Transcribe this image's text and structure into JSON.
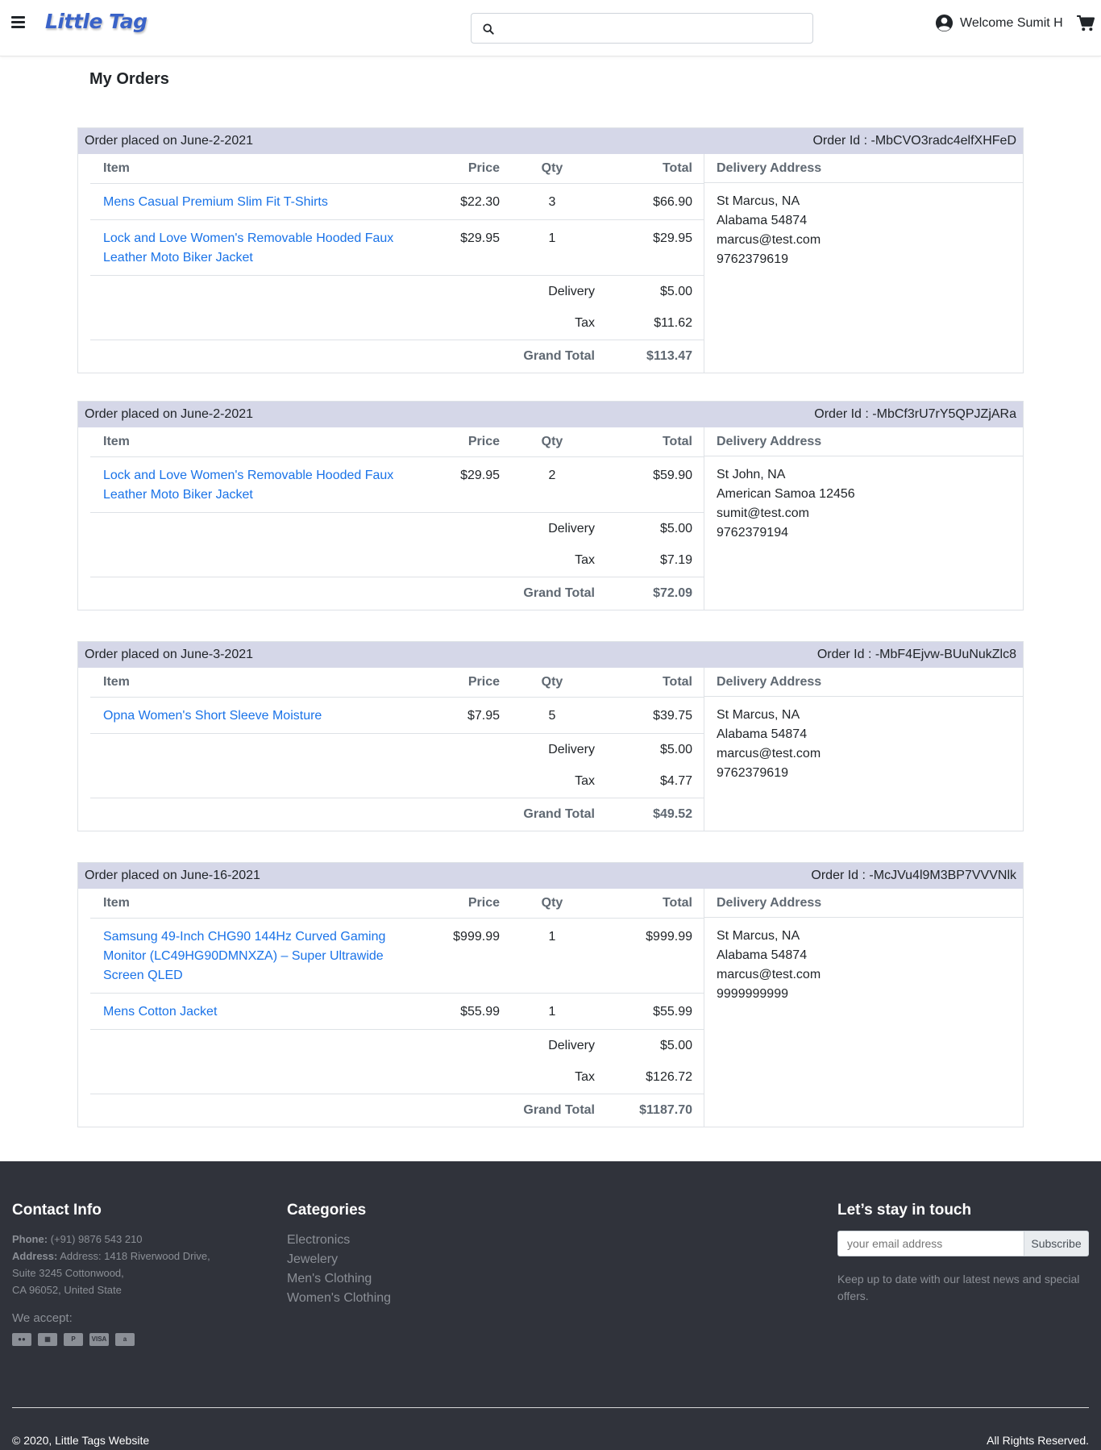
{
  "header": {
    "logo": "Little Tag",
    "search_placeholder": "",
    "welcome": "Welcome Sumit H"
  },
  "page_title": "My Orders",
  "columns": {
    "item": "Item",
    "price": "Price",
    "qty": "Qty",
    "total": "Total",
    "delivery_address": "Delivery Address"
  },
  "summary_labels": {
    "delivery": "Delivery",
    "tax": "Tax",
    "grand_total": "Grand Total"
  },
  "orders": [
    {
      "placed": "Order placed on June-2-2021",
      "order_id": "Order Id : -MbCVO3radc4elfXHFeD",
      "items": [
        {
          "name": "Mens Casual Premium Slim Fit T-Shirts",
          "price": "$22.30",
          "qty": "3",
          "total": "$66.90"
        },
        {
          "name": "Lock and Love Women's Removable Hooded Faux Leather Moto Biker Jacket",
          "price": "$29.95",
          "qty": "1",
          "total": "$29.95"
        }
      ],
      "delivery": "$5.00",
      "tax": "$11.62",
      "grand_total": "$113.47",
      "address": [
        "St Marcus, NA",
        "Alabama 54874",
        "marcus@test.com",
        "9762379619"
      ]
    },
    {
      "placed": "Order placed on June-2-2021",
      "order_id": "Order Id : -MbCf3rU7rY5QPJZjARa",
      "items": [
        {
          "name": "Lock and Love Women's Removable Hooded Faux Leather Moto Biker Jacket",
          "price": "$29.95",
          "qty": "2",
          "total": "$59.90"
        }
      ],
      "delivery": "$5.00",
      "tax": "$7.19",
      "grand_total": "$72.09",
      "address": [
        "St John, NA",
        "American Samoa 12456",
        "sumit@test.com",
        "9762379194"
      ]
    },
    {
      "placed": "Order placed on June-3-2021",
      "order_id": "Order Id : -MbF4Ejvw-BUuNukZlc8",
      "items": [
        {
          "name": "Opna Women's Short Sleeve Moisture",
          "price": "$7.95",
          "qty": "5",
          "total": "$39.75"
        }
      ],
      "delivery": "$5.00",
      "tax": "$4.77",
      "grand_total": "$49.52",
      "address": [
        "St Marcus, NA",
        "Alabama 54874",
        "marcus@test.com",
        "9762379619"
      ]
    },
    {
      "placed": "Order placed on June-16-2021",
      "order_id": "Order Id : -McJVu4l9M3BP7VVVNlk",
      "items": [
        {
          "name": "Samsung 49-Inch CHG90 144Hz Curved Gaming Monitor (LC49HG90DMNXZA) – Super Ultrawide Screen QLED",
          "price": "$999.99",
          "qty": "1",
          "total": "$999.99"
        },
        {
          "name": "Mens Cotton Jacket",
          "price": "$55.99",
          "qty": "1",
          "total": "$55.99"
        }
      ],
      "delivery": "$5.00",
      "tax": "$126.72",
      "grand_total": "$1187.70",
      "address": [
        "St Marcus, NA",
        "Alabama 54874",
        "marcus@test.com",
        "9999999999"
      ]
    }
  ],
  "footer": {
    "contact_title": "Contact Info",
    "phone_label": "Phone:",
    "phone": "(+91) 9876 543 210",
    "address_label": "Address:",
    "address_lines": [
      "Address: 1418 Riverwood Drive,",
      "Suite 3245 Cottonwood,",
      "CA 96052, United State"
    ],
    "we_accept": "We accept:",
    "payment_icons": [
      "mastercard-icon",
      "card-icon",
      "paypal-icon",
      "visa-icon",
      "amazon-icon"
    ],
    "categories_title": "Categories",
    "categories": [
      "Electronics",
      "Jewelery",
      "Men's Clothing",
      "Women's Clothing"
    ],
    "newsletter_title": "Let’s stay in touch",
    "email_placeholder": "your email address",
    "subscribe": "Subscribe",
    "newsletter_note": "Keep up to date with our latest news and special offers.",
    "copyright": "© 2020, Little Tags Website",
    "rights": "All Rights Reserved."
  },
  "colors": {
    "order_header_bg": "#d5d7e8",
    "link": "#1a73e8",
    "footer_bg": "#30333b",
    "logo": "#3a63c8"
  }
}
